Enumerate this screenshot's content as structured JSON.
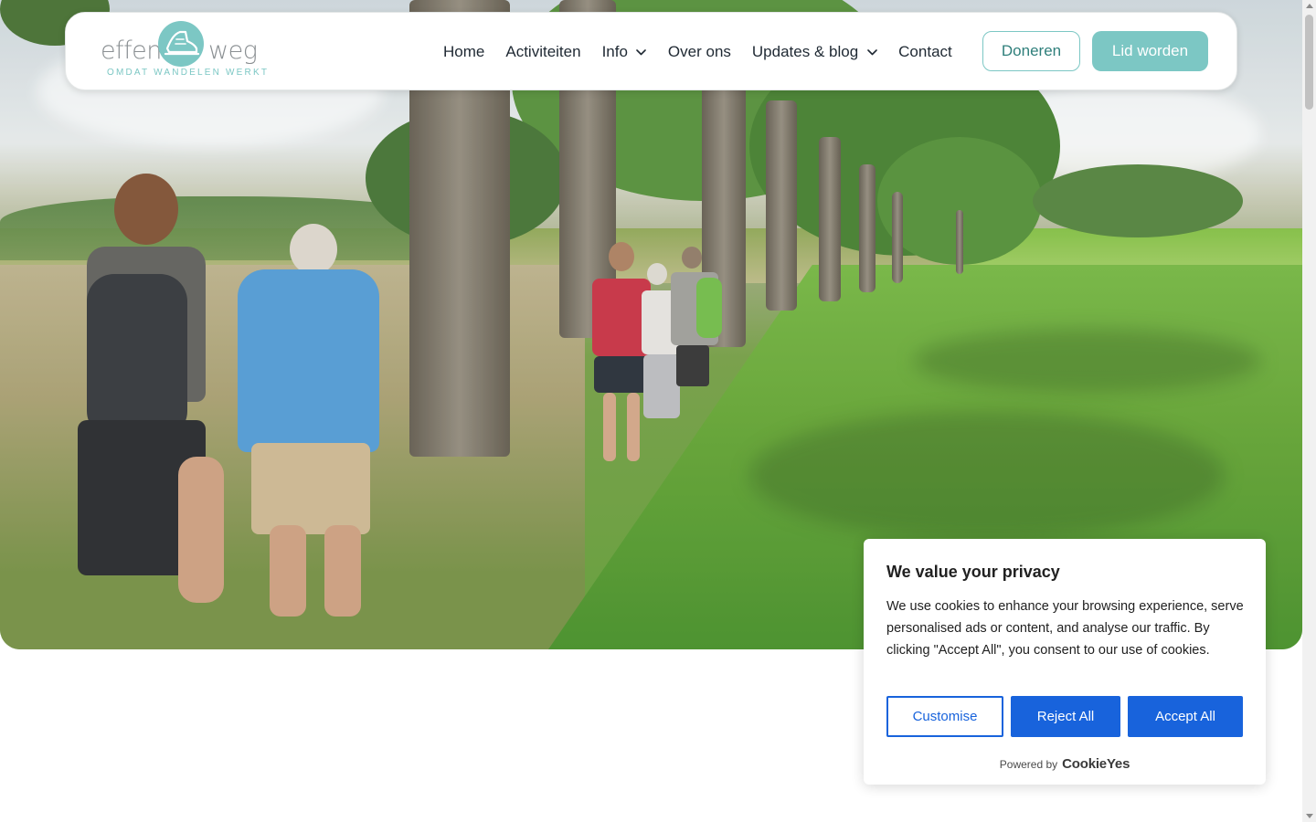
{
  "logo": {
    "word_left": "effen",
    "word_right": "weg",
    "tagline": "OMDAT WANDELEN WERKT"
  },
  "nav": {
    "items": [
      {
        "label": "Home"
      },
      {
        "label": "Activiteiten"
      },
      {
        "label": "Info"
      },
      {
        "label": "Over ons"
      },
      {
        "label": "Updates & blog"
      },
      {
        "label": "Contact"
      }
    ]
  },
  "actions": {
    "donate_label": "Doneren",
    "member_label": "Lid worden"
  },
  "colors": {
    "brand_teal": "#7cc7c4",
    "cookie_blue": "#1863dc"
  },
  "cookie_banner": {
    "title": "We value your privacy",
    "body": "We use cookies to enhance your browsing experience, serve personalised ads or content, and analyse our traffic. By clicking \"Accept All\", you consent to our use of cookies.",
    "customise_label": "Customise",
    "reject_label": "Reject All",
    "accept_label": "Accept All",
    "powered_by": "Powered by",
    "powered_brand": "CookieYes"
  }
}
